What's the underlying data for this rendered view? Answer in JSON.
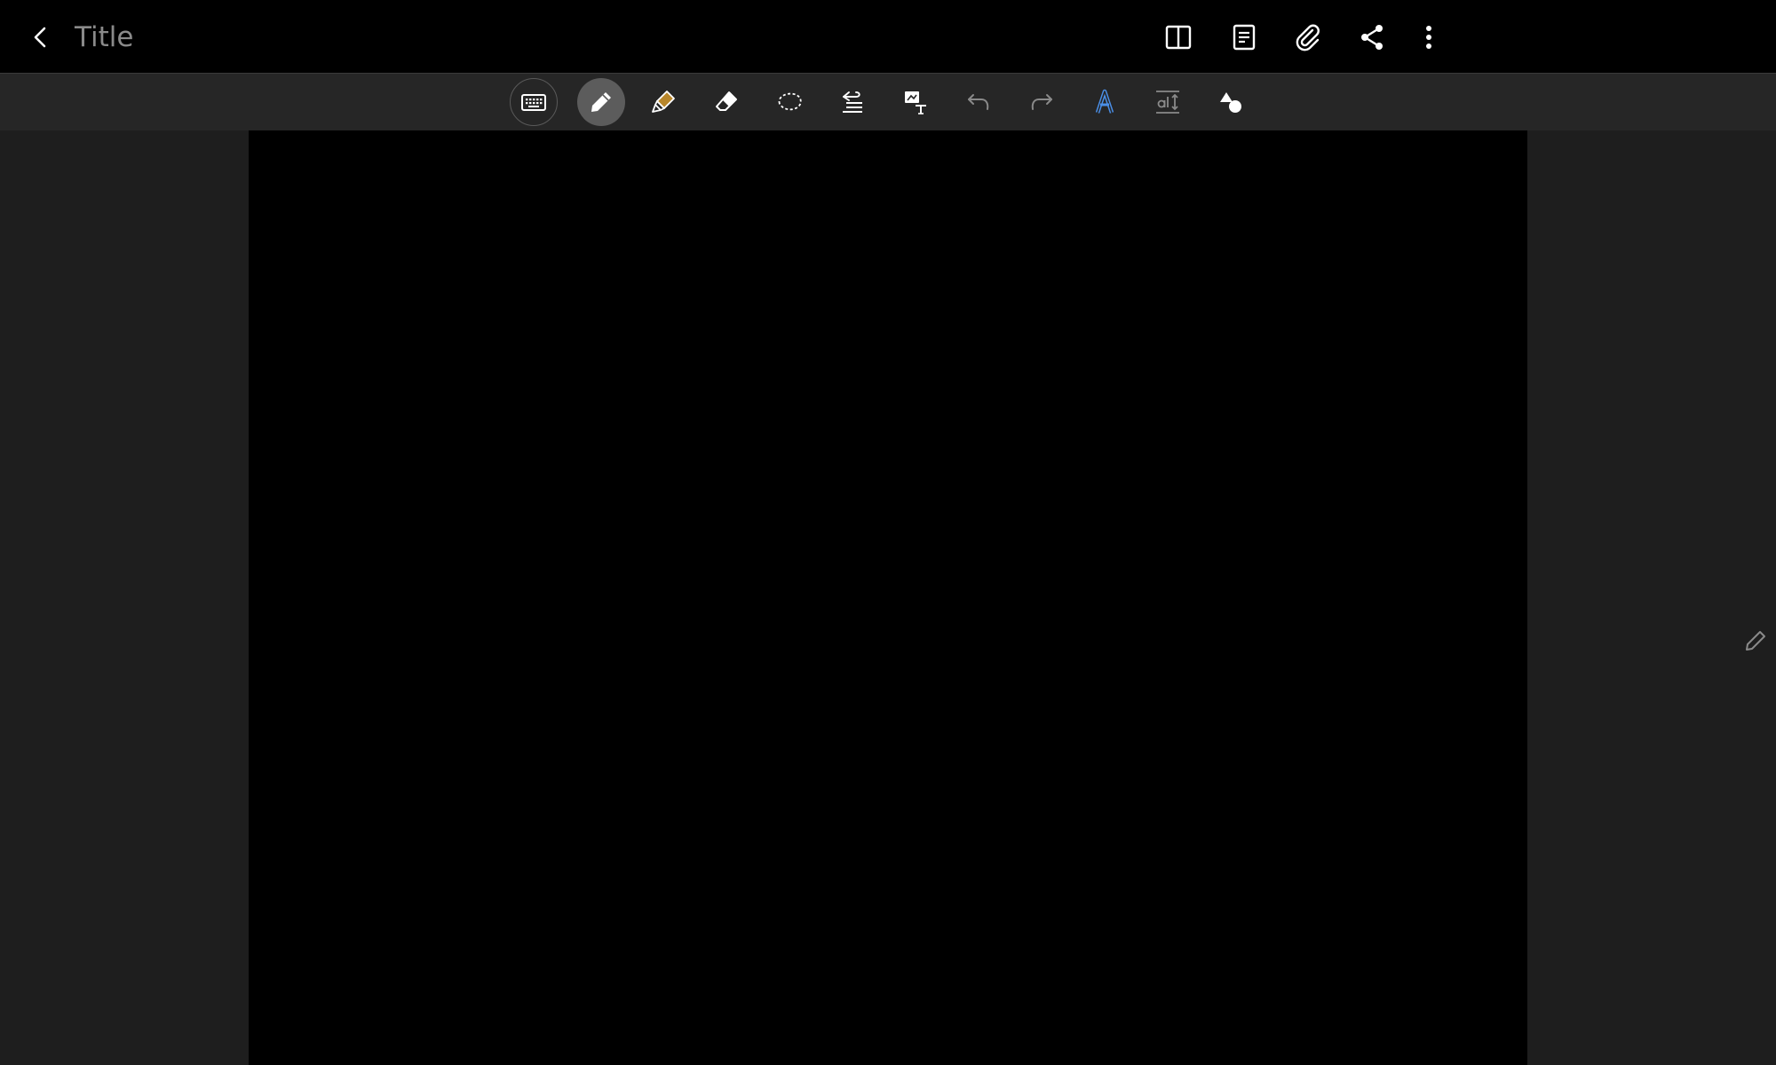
{
  "header": {
    "title": "Title"
  },
  "icons": {
    "back": "chevron-left-icon",
    "book_view": "book-view-icon",
    "page_template": "page-template-icon",
    "attach": "paperclip-icon",
    "share": "share-icon",
    "more": "more-vert-icon",
    "keyboard": "keyboard-icon",
    "pen": "pen-icon",
    "highlighter": "highlighter-icon",
    "eraser": "eraser-icon",
    "lasso": "lasso-icon",
    "text_wrap": "text-wrap-icon",
    "image_text": "image-text-icon",
    "undo": "undo-icon",
    "redo": "redo-icon",
    "text_style": "text-style-icon",
    "text_spacing": "text-spacing-icon",
    "shapes": "shapes-icon",
    "side_pen": "pencil-icon"
  },
  "colors": {
    "highlighter_accent": "#b8862a",
    "text_style_accent": "#4a8fe8",
    "shape_accent": "#ffffff"
  },
  "toolbar": {
    "active_tool": "pen"
  }
}
